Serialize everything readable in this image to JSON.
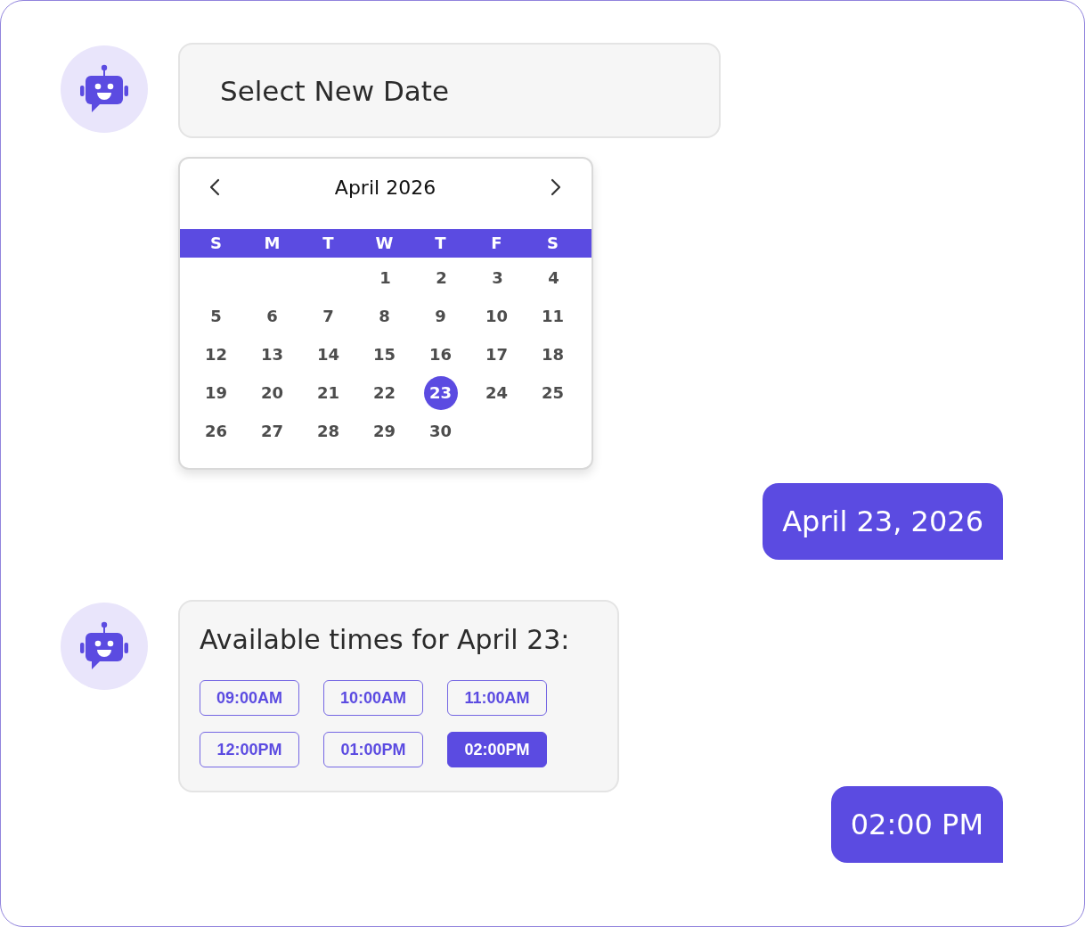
{
  "messages": [
    {
      "kind": "bot",
      "text": "Select New Date",
      "calendar": {
        "month": "April 2026",
        "weekdays": [
          "S",
          "M",
          "T",
          "W",
          "T",
          "F",
          "S"
        ],
        "weeks": [
          {
            "right_aligned": true,
            "days": [
              {
                "label": "1",
                "selected": false
              },
              {
                "label": "2",
                "selected": false
              },
              {
                "label": "3",
                "selected": false
              },
              {
                "label": "4",
                "selected": false
              }
            ]
          },
          {
            "right_aligned": false,
            "days": [
              {
                "label": "5",
                "selected": false
              },
              {
                "label": "6",
                "selected": false
              },
              {
                "label": "7",
                "selected": false
              },
              {
                "label": "8",
                "selected": false
              },
              {
                "label": "9",
                "selected": false
              },
              {
                "label": "10",
                "selected": false
              },
              {
                "label": "11",
                "selected": false
              }
            ]
          },
          {
            "right_aligned": false,
            "days": [
              {
                "label": "12",
                "selected": false
              },
              {
                "label": "13",
                "selected": false
              },
              {
                "label": "14",
                "selected": false
              },
              {
                "label": "15",
                "selected": false
              },
              {
                "label": "16",
                "selected": false
              },
              {
                "label": "17",
                "selected": false
              },
              {
                "label": "18",
                "selected": false
              }
            ]
          },
          {
            "right_aligned": false,
            "days": [
              {
                "label": "19",
                "selected": false
              },
              {
                "label": "20",
                "selected": false
              },
              {
                "label": "21",
                "selected": false
              },
              {
                "label": "22",
                "selected": false
              },
              {
                "label": "23",
                "selected": true
              },
              {
                "label": "24",
                "selected": false
              },
              {
                "label": "25",
                "selected": false
              }
            ]
          },
          {
            "right_aligned": false,
            "days": [
              {
                "label": "26",
                "selected": false
              },
              {
                "label": "27",
                "selected": false
              },
              {
                "label": "28",
                "selected": false
              },
              {
                "label": "29",
                "selected": false
              },
              {
                "label": "30",
                "selected": false
              }
            ]
          }
        ]
      }
    },
    {
      "kind": "user",
      "text": "April 23, 2026"
    },
    {
      "kind": "bot",
      "text": "Available times for April 23:",
      "time_slots": [
        {
          "label": "09:00AM",
          "selected": false
        },
        {
          "label": "10:00AM",
          "selected": false
        },
        {
          "label": "11:00AM",
          "selected": false
        },
        {
          "label": "12:00PM",
          "selected": false
        },
        {
          "label": "01:00PM",
          "selected": false
        },
        {
          "label": "02:00PM",
          "selected": true
        }
      ]
    },
    {
      "kind": "user",
      "text": "02:00 PM"
    }
  ]
}
